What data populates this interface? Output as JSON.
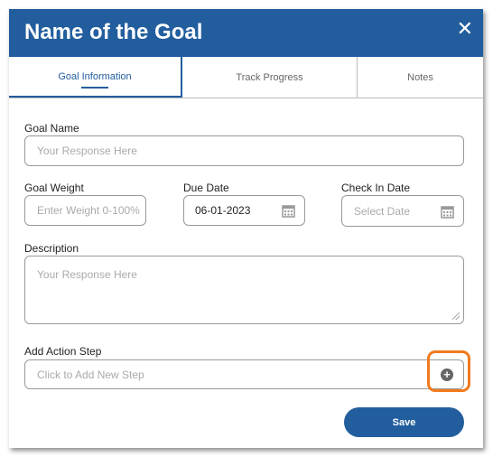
{
  "dialog": {
    "title": "Name of the Goal",
    "close_icon": "close-icon"
  },
  "tabs": [
    {
      "label": "Goal Information",
      "active": true
    },
    {
      "label": "Track Progress"
    },
    {
      "label": "Notes"
    }
  ],
  "form": {
    "goal_name": {
      "label": "Goal Name",
      "placeholder": "Your Response Here"
    },
    "goal_weight": {
      "label": "Goal Weight",
      "placeholder": "Enter Weight 0-100%"
    },
    "due_date": {
      "label": "Due Date",
      "value": "06-01-2023"
    },
    "check_in_date": {
      "label": "Check In Date",
      "placeholder": "Select Date"
    },
    "description": {
      "label": "Description",
      "placeholder": "Your Response Here"
    },
    "action_step": {
      "label": "Add Action Step",
      "placeholder": "Click to Add New Step"
    }
  },
  "save_label": "Save",
  "colors": {
    "primary": "#225e9e",
    "highlight": "#f07a1e"
  }
}
